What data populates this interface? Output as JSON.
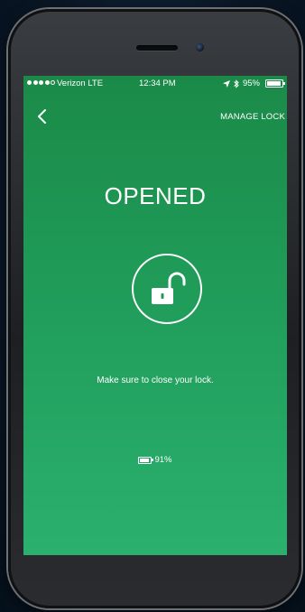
{
  "status_bar": {
    "carrier": "Verizon LTE",
    "time": "12:34 PM",
    "battery_percent": "95%",
    "signal_bars_filled": 4,
    "signal_bars_total": 5
  },
  "header": {
    "back_icon": "chevron-left-icon",
    "manage_lock_label": "MANAGE LOCK"
  },
  "lock_status": {
    "title": "OPENED",
    "icon": "open-padlock-icon",
    "message": "Make sure to close your lock.",
    "battery_icon": "battery-icon",
    "battery_level": "91%"
  },
  "theme": {
    "accent": "#1f9a57",
    "text": "#ffffff"
  }
}
